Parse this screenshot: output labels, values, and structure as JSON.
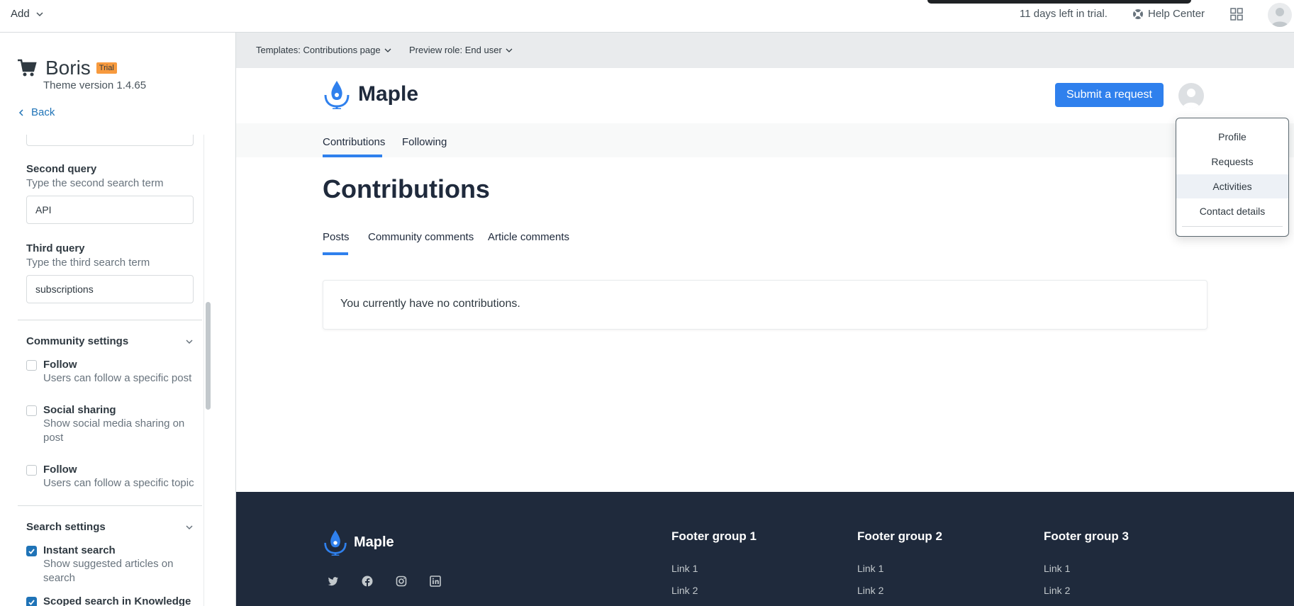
{
  "topbar": {
    "add_label": "Add",
    "trial_text": "11 days left in trial.",
    "help_center_label": "Help Center"
  },
  "sidebar": {
    "brand_name": "Boris",
    "trial_badge": "Trial",
    "theme_version": "Theme version 1.4.65",
    "back_label": "Back",
    "partial_input_value": "-",
    "second_query": {
      "label": "Second query",
      "hint": "Type the second search term",
      "value": "API"
    },
    "third_query": {
      "label": "Third query",
      "hint": "Type the third search term",
      "value": "subscriptions"
    },
    "community_settings": {
      "title": "Community settings",
      "items": [
        {
          "title": "Follow",
          "desc": "Users can follow a specific post",
          "checked": false
        },
        {
          "title": "Social sharing",
          "desc": "Show social media sharing on post",
          "checked": false
        },
        {
          "title": "Follow",
          "desc": "Users can follow a specific topic",
          "checked": false
        }
      ]
    },
    "search_settings": {
      "title": "Search settings",
      "items": [
        {
          "title": "Instant search",
          "desc": "Show suggested articles on search",
          "checked": true
        },
        {
          "title": "Scoped search in Knowledge",
          "desc": "",
          "checked": true
        }
      ]
    }
  },
  "preview": {
    "template_label": "Templates: Contributions page",
    "role_label": "Preview role: End user",
    "logo_text": "Maple",
    "submit_label": "Submit a request",
    "tabs": [
      "Contributions",
      "Following"
    ],
    "page_title": "Contributions",
    "sub_tabs": [
      "Posts",
      "Community comments",
      "Article comments"
    ],
    "empty_message": "You currently have no contributions.",
    "dropdown": [
      "Profile",
      "Requests",
      "Activities",
      "Contact details"
    ],
    "footer": {
      "logo_text": "Maple",
      "social_icons": [
        "twitter-icon",
        "facebook-icon",
        "instagram-icon",
        "linkedin-icon"
      ],
      "groups": [
        {
          "title": "Footer group 1",
          "links": [
            "Link 1",
            "Link 2"
          ]
        },
        {
          "title": "Footer group 2",
          "links": [
            "Link 1",
            "Link 2"
          ]
        },
        {
          "title": "Footer group 3",
          "links": [
            "Link 1",
            "Link 2"
          ]
        }
      ]
    }
  },
  "colors": {
    "accent": "#2f80ed",
    "link": "#1f73b7",
    "footer_bg": "#1f2a3c",
    "trial_badge": "#f79a3e"
  }
}
